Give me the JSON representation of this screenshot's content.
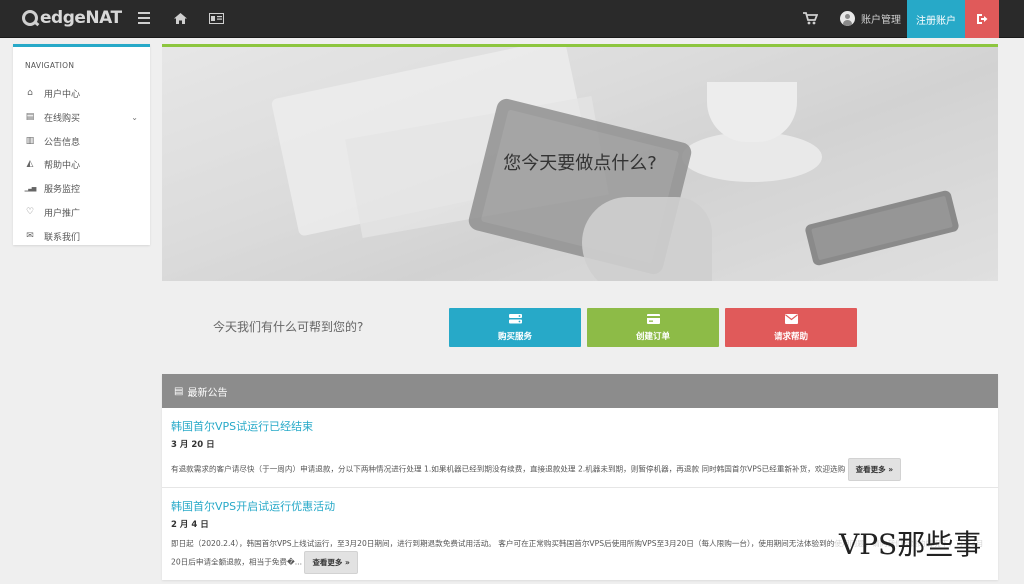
{
  "header": {
    "logo_text": "edgeNAT",
    "account_label": "账户管理",
    "register_label": "注册账户",
    "icons": [
      "menu-icon",
      "home-icon",
      "id-card-icon",
      "cart-icon",
      "user-avatar-icon",
      "logout-icon"
    ]
  },
  "sidebar": {
    "title": "NAVIGATION",
    "items": [
      {
        "label": "用户中心",
        "icon": "home-icon",
        "glyph": "⌂"
      },
      {
        "label": "在线购买",
        "icon": "server-icon",
        "glyph": "▤",
        "has_submenu": true
      },
      {
        "label": "公告信息",
        "icon": "newspaper-icon",
        "glyph": "▥"
      },
      {
        "label": "帮助中心",
        "icon": "graduation-cap-icon",
        "glyph": "◭"
      },
      {
        "label": "服务监控",
        "icon": "signal-icon",
        "glyph": "▁▃▅"
      },
      {
        "label": "用户推广",
        "icon": "heart-icon",
        "glyph": "♡"
      },
      {
        "label": "联系我们",
        "icon": "envelope-icon",
        "glyph": "✉"
      }
    ]
  },
  "hero": {
    "title": "您今天要做点什么?"
  },
  "help_row": {
    "prompt": "今天我们有什么可帮到您的?",
    "buttons": [
      {
        "label": "购买服务",
        "icon": "server-icon",
        "color": "#27a9c8"
      },
      {
        "label": "创建订单",
        "icon": "card-icon",
        "color": "#8dbb47"
      },
      {
        "label": "请求帮助",
        "icon": "envelope-icon",
        "color": "#e05a5a"
      }
    ]
  },
  "announcements": {
    "heading": "最新公告",
    "posts": [
      {
        "title": "韩国首尔VPS试运行已经结束",
        "date": "3 月 20 日",
        "body": "有退款需求的客户请尽快（于一周内）申请退款，分以下两种情况进行处理 1.如果机器已经到期没有续费，直接退款处理 2.机器未到期，则暂停机器，再退款 同时韩国首尔VPS已经重新补货，欢迎选购",
        "more": "查看更多 »"
      },
      {
        "title": "韩国首尔VPS开启试运行优惠活动",
        "date": "2 月 4 日",
        "body": "即日起（2020.2.4），韩国首尔VPS上线试运行，至3月20日期间，进行到期退款免费试用活动。 客户可在正常购买韩国首尔VPS后使用所购VPS至3月20日（每人限购一台），使用期间无法体验到的使用问题，请向我们反馈的情况下，可在3月20日后申请全额退款，相当于免费�...",
        "more": "查看更多 »"
      }
    ]
  },
  "watermark": "VPS那些事",
  "colors": {
    "accent_blue": "#27a9c8",
    "accent_green": "#8dbb47",
    "accent_red": "#e05a5a",
    "topbar": "#2a2a2a"
  }
}
